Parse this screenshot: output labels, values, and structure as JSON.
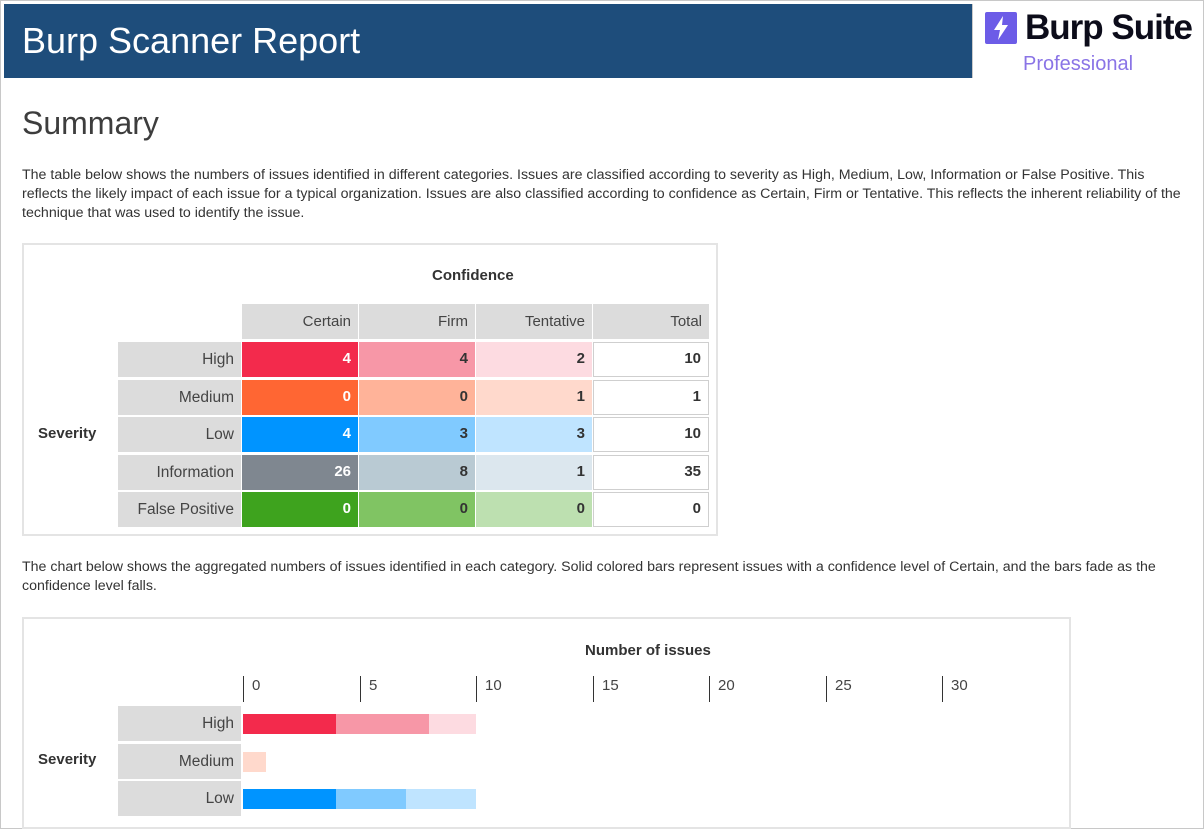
{
  "header": {
    "title": "Burp Scanner Report",
    "logo": {
      "name": "Burp Suite",
      "edition": "Professional",
      "icon": "lightning-bolt-icon",
      "color": "#6c5ce7"
    }
  },
  "summary": {
    "heading": "Summary",
    "intro": "The table below shows the numbers of issues identified in different categories. Issues are classified according to severity as High, Medium, Low, Information or False Positive. This reflects the likely impact of each issue for a typical organization. Issues are also classified according to confidence as Certain, Firm or Tentative. This reflects the inherent reliability of the technique that was used to identify the issue.",
    "chart_intro": "The chart below shows the aggregated numbers of issues identified in each category. Solid colored bars represent issues with a confidence level of Certain, and the bars fade as the confidence level falls."
  },
  "table": {
    "title": "Confidence",
    "row_axis": "Severity",
    "columns": [
      "Certain",
      "Firm",
      "Tentative",
      "Total"
    ],
    "rows": [
      {
        "label": "High",
        "values": [
          "4",
          "4",
          "2",
          "10"
        ],
        "colors": [
          "#f32a4c",
          "#f797a7",
          "#fddbe1"
        ]
      },
      {
        "label": "Medium",
        "values": [
          "0",
          "0",
          "1",
          "1"
        ],
        "colors": [
          "#ff6633",
          "#ffb399",
          "#ffd9cc"
        ]
      },
      {
        "label": "Low",
        "values": [
          "4",
          "3",
          "3",
          "10"
        ],
        "colors": [
          "#0094ff",
          "#80caff",
          "#bfe4ff"
        ]
      },
      {
        "label": "Information",
        "values": [
          "26",
          "8",
          "1",
          "35"
        ],
        "colors": [
          "#7f8790",
          "#b9cad3",
          "#dce7ee"
        ]
      },
      {
        "label": "False Positive",
        "values": [
          "0",
          "0",
          "0",
          "0"
        ],
        "colors": [
          "#3ea31e",
          "#80c463",
          "#bde0b0"
        ]
      }
    ]
  },
  "chart_data": {
    "type": "bar",
    "title": "Number of issues",
    "ylabel": "Severity",
    "categories": [
      "High",
      "Medium",
      "Low"
    ],
    "ticks": [
      "0",
      "5",
      "10",
      "15",
      "20",
      "25",
      "30"
    ],
    "xlim": [
      0,
      30
    ],
    "series": [
      {
        "name": "Certain",
        "values": [
          4,
          0,
          4
        ]
      },
      {
        "name": "Firm",
        "values": [
          4,
          0,
          3
        ]
      },
      {
        "name": "Tentative",
        "values": [
          2,
          1,
          3
        ]
      }
    ],
    "colors": [
      [
        "#f32a4c",
        "#f797a7",
        "#fddbe1"
      ],
      [
        "#ff6633",
        "#ffb399",
        "#ffd9cc"
      ],
      [
        "#0094ff",
        "#80caff",
        "#bfe4ff"
      ]
    ]
  }
}
